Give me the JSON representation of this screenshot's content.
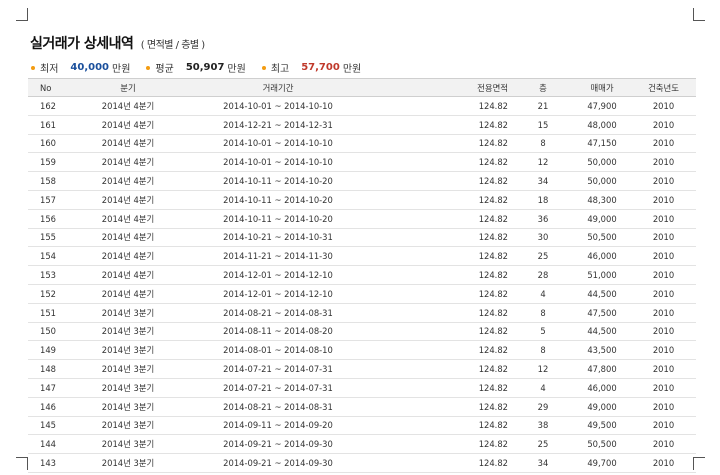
{
  "title": {
    "main": "실거래가 상세내역",
    "sub": "( 면적별 / 층별 )"
  },
  "summary": [
    {
      "label": "최저",
      "value": "40,000",
      "unit": "만원",
      "color": "#1a4f9c"
    },
    {
      "label": "평균",
      "value": "50,907",
      "unit": "만원",
      "color": "#222222"
    },
    {
      "label": "최고",
      "value": "57,700",
      "unit": "만원",
      "color": "#c0392b"
    }
  ],
  "table": {
    "headers": [
      "No",
      "분기",
      "거래기간",
      "전용면적",
      "층",
      "매매가",
      "건축년도"
    ],
    "rows": [
      [
        "162",
        "2014년 4분기",
        "2014-10-01 ~ 2014-10-10",
        "124.82",
        "21",
        "47,900",
        "2010"
      ],
      [
        "161",
        "2014년 4분기",
        "2014-12-21 ~ 2014-12-31",
        "124.82",
        "15",
        "48,000",
        "2010"
      ],
      [
        "160",
        "2014년 4분기",
        "2014-10-01 ~ 2014-10-10",
        "124.82",
        "8",
        "47,150",
        "2010"
      ],
      [
        "159",
        "2014년 4분기",
        "2014-10-01 ~ 2014-10-10",
        "124.82",
        "12",
        "50,000",
        "2010"
      ],
      [
        "158",
        "2014년 4분기",
        "2014-10-11 ~ 2014-10-20",
        "124.82",
        "34",
        "50,000",
        "2010"
      ],
      [
        "157",
        "2014년 4분기",
        "2014-10-11 ~ 2014-10-20",
        "124.82",
        "18",
        "48,300",
        "2010"
      ],
      [
        "156",
        "2014년 4분기",
        "2014-10-11 ~ 2014-10-20",
        "124.82",
        "36",
        "49,000",
        "2010"
      ],
      [
        "155",
        "2014년 4분기",
        "2014-10-21 ~ 2014-10-31",
        "124.82",
        "30",
        "50,500",
        "2010"
      ],
      [
        "154",
        "2014년 4분기",
        "2014-11-21 ~ 2014-11-30",
        "124.82",
        "25",
        "46,000",
        "2010"
      ],
      [
        "153",
        "2014년 4분기",
        "2014-12-01 ~ 2014-12-10",
        "124.82",
        "28",
        "51,000",
        "2010"
      ],
      [
        "152",
        "2014년 4분기",
        "2014-12-01 ~ 2014-12-10",
        "124.82",
        "4",
        "44,500",
        "2010"
      ],
      [
        "151",
        "2014년 3분기",
        "2014-08-21 ~ 2014-08-31",
        "124.82",
        "8",
        "47,500",
        "2010"
      ],
      [
        "150",
        "2014년 3분기",
        "2014-08-11 ~ 2014-08-20",
        "124.82",
        "5",
        "44,500",
        "2010"
      ],
      [
        "149",
        "2014년 3분기",
        "2014-08-01 ~ 2014-08-10",
        "124.82",
        "8",
        "43,500",
        "2010"
      ],
      [
        "148",
        "2014년 3분기",
        "2014-07-21 ~ 2014-07-31",
        "124.82",
        "12",
        "47,800",
        "2010"
      ],
      [
        "147",
        "2014년 3분기",
        "2014-07-21 ~ 2014-07-31",
        "124.82",
        "4",
        "46,000",
        "2010"
      ],
      [
        "146",
        "2014년 3분기",
        "2014-08-21 ~ 2014-08-31",
        "124.82",
        "29",
        "49,000",
        "2010"
      ],
      [
        "145",
        "2014년 3분기",
        "2014-09-11 ~ 2014-09-20",
        "124.82",
        "38",
        "49,500",
        "2010"
      ],
      [
        "144",
        "2014년 3분기",
        "2014-09-21 ~ 2014-09-30",
        "124.82",
        "25",
        "50,500",
        "2010"
      ],
      [
        "143",
        "2014년 3분기",
        "2014-09-21 ~ 2014-09-30",
        "124.82",
        "34",
        "49,700",
        "2010"
      ]
    ]
  }
}
